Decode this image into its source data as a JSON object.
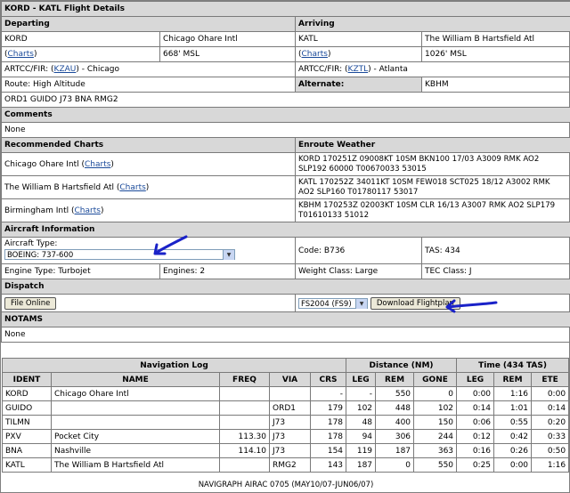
{
  "title": "KORD - KATL Flight Details",
  "departing": {
    "header": "Departing",
    "icao": "KORD",
    "name": "Chicago Ohare Intl",
    "charts_open": "(",
    "charts_link": "Charts",
    "charts_close": ")",
    "elevation": "668' MSL",
    "artcc_prefix": "ARTCC/FIR: (",
    "artcc_code": "KZAU",
    "artcc_suffix": ") - Chicago"
  },
  "arriving": {
    "header": "Arriving",
    "icao": "KATL",
    "name": "The William B Hartsfield Atl",
    "charts_open": "(",
    "charts_link": "Charts",
    "charts_close": ")",
    "elevation": "1026' MSL",
    "artcc_prefix": "ARTCC/FIR: (",
    "artcc_code": "KZTL",
    "artcc_suffix": ") - Atlanta"
  },
  "route_label": "Route: High Altitude",
  "alternate_label": "Alternate:",
  "alternate_value": "KBHM",
  "route_string": "ORD1 GUIDO J73 BNA RMG2",
  "comments": {
    "header": "Comments",
    "value": "None"
  },
  "recommended_charts": {
    "header": "Recommended Charts",
    "items": [
      {
        "name": "Chicago Ohare Intl (",
        "link": "Charts",
        "close": ")"
      },
      {
        "name": "The William B Hartsfield Atl (",
        "link": "Charts",
        "close": ")"
      },
      {
        "name": "Birmingham Intl (",
        "link": "Charts",
        "close": ")"
      }
    ]
  },
  "enroute_weather": {
    "header": "Enroute Weather",
    "items": [
      "KORD 170251Z 09008KT 10SM BKN100 17/03 A3009 RMK AO2 SLP192 60000 T00670033 53015",
      "KATL 170252Z 34011KT 10SM FEW018 SCT025 18/12 A3002 RMK AO2 SLP160 T01780117 53017",
      "KBHM 170253Z 02003KT 10SM CLR 16/13 A3007 RMK AO2 SLP179 T01610133 51012"
    ]
  },
  "aircraft": {
    "header": "Aircraft Information",
    "type_label": "Aircraft Type:",
    "type_value": "BOEING: 737-600",
    "code": "Code: B736",
    "tas": "TAS: 434",
    "engine_type": "Engine Type: Turbojet",
    "engines": "Engines: 2",
    "weight_class": "Weight Class: Large",
    "tec_class": "TEC Class: J"
  },
  "dispatch": {
    "header": "Dispatch",
    "file_online": "File Online",
    "format_value": "FS2004 (FS9)",
    "download": "Download Flightplan"
  },
  "notams": {
    "header": "NOTAMS",
    "value": "None"
  },
  "nav_log": {
    "title": "Navigation Log",
    "distance_header": "Distance (NM)",
    "time_header": "Time (434 TAS)",
    "columns": [
      "IDENT",
      "NAME",
      "FREQ",
      "VIA",
      "CRS",
      "LEG",
      "REM",
      "GONE",
      "LEG",
      "REM",
      "ETE"
    ],
    "rows": [
      [
        "KORD",
        "Chicago Ohare Intl",
        "",
        "",
        "-",
        "-",
        "550",
        "0",
        "0:00",
        "1:16",
        "0:00"
      ],
      [
        "GUIDO",
        "",
        "",
        "ORD1",
        "179",
        "102",
        "448",
        "102",
        "0:14",
        "1:01",
        "0:14"
      ],
      [
        "TILMN",
        "",
        "",
        "J73",
        "178",
        "48",
        "400",
        "150",
        "0:06",
        "0:55",
        "0:20"
      ],
      [
        "PXV",
        "Pocket City",
        "113.30",
        "J73",
        "178",
        "94",
        "306",
        "244",
        "0:12",
        "0:42",
        "0:33"
      ],
      [
        "BNA",
        "Nashville",
        "114.10",
        "J73",
        "154",
        "119",
        "187",
        "363",
        "0:16",
        "0:26",
        "0:50"
      ],
      [
        "KATL",
        "The William B Hartsfield Atl",
        "",
        "RMG2",
        "143",
        "187",
        "0",
        "550",
        "0:25",
        "0:00",
        "1:16"
      ]
    ]
  },
  "footer": "NAVIGRAPH AIRAC 0705 (MAY10/07-JUN06/07)",
  "colors": {
    "header_bg": "#d8d8d8",
    "link": "#1a4a9a",
    "annotation_arrow": "#1a22c8"
  }
}
